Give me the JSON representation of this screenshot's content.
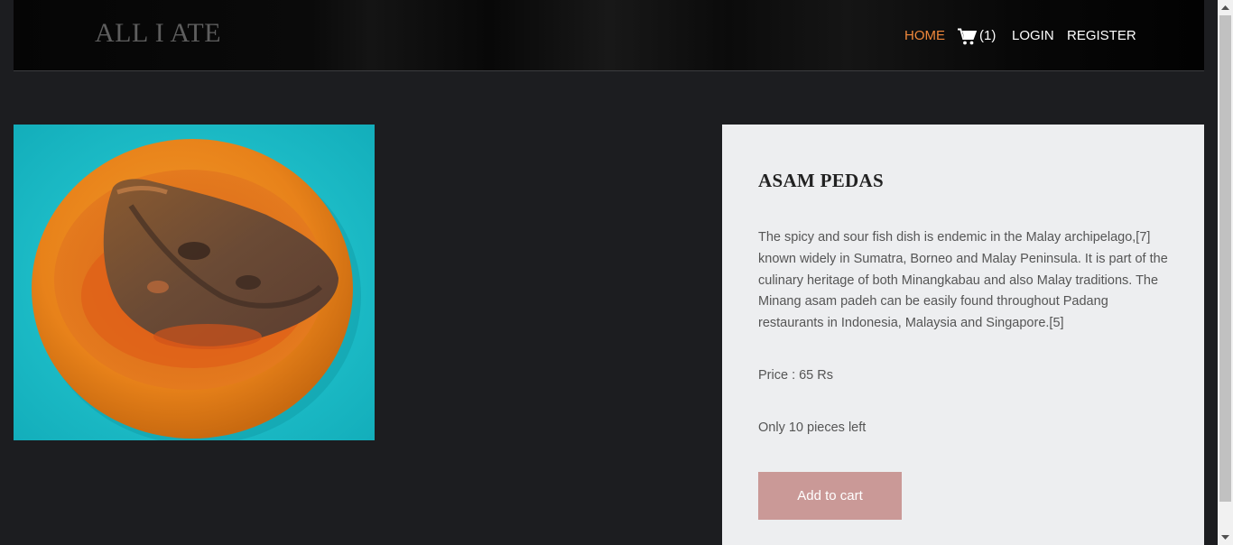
{
  "brand": {
    "logo_text": "ALL I ATE"
  },
  "nav": {
    "home": "HOME",
    "cart_count": "(1)",
    "login": "LOGIN",
    "register": "REGISTER",
    "active_color": "#f0883b",
    "cart_icon": "shopping-cart-icon"
  },
  "product": {
    "image_alt": "Asam pedas fish on an orange plate",
    "title": "ASAM PEDAS",
    "description": "The spicy and sour fish dish is endemic in the Malay archipelago,[7] known widely in Sumatra, Borneo and Malay Peninsula. It is part of the culinary heritage of both Minangkabau and also Malay traditions. The Minang asam padeh can be easily found throughout Padang restaurants in Indonesia, Malaysia and Singapore.[5]",
    "price": "Price : 65 Rs",
    "stock": "Only 10 pieces left",
    "add_to_cart_label": "Add to cart",
    "button_color": "#ca9997"
  }
}
